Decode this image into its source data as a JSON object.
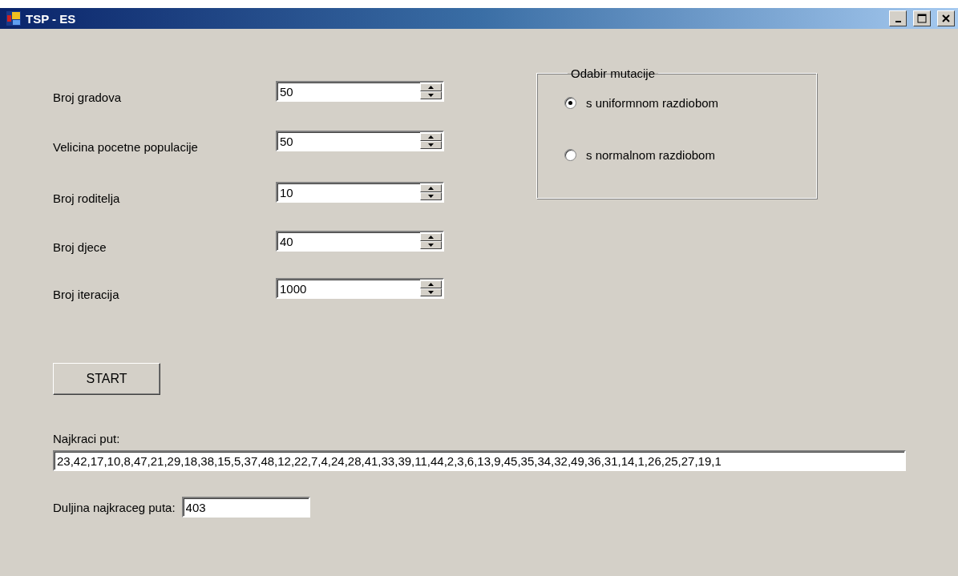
{
  "window": {
    "title": "TSP - ES"
  },
  "parameters": [
    {
      "label": "Broj gradova",
      "value": "50"
    },
    {
      "label": "Velicina pocetne populacije",
      "value": "50"
    },
    {
      "label": "Broj roditelja",
      "value": "10"
    },
    {
      "label": "Broj djece",
      "value": "40"
    },
    {
      "label": "Broj iteracija",
      "value": "1000"
    }
  ],
  "mutation": {
    "title": "Odabir mutacije",
    "options": [
      {
        "label": "s uniformnom razdiobom",
        "selected": true
      },
      {
        "label": "s normalnom razdiobom",
        "selected": false
      }
    ]
  },
  "start_button": "START",
  "shortest_path": {
    "label": "Najkraci put:",
    "value": "23,42,17,10,8,47,21,29,18,38,15,5,37,48,12,22,7,4,24,28,41,33,39,11,44,2,3,6,13,9,45,35,34,32,49,36,31,14,1,26,25,27,19,1"
  },
  "shortest_length": {
    "label": "Duljina najkraceg puta:",
    "value": "403"
  }
}
